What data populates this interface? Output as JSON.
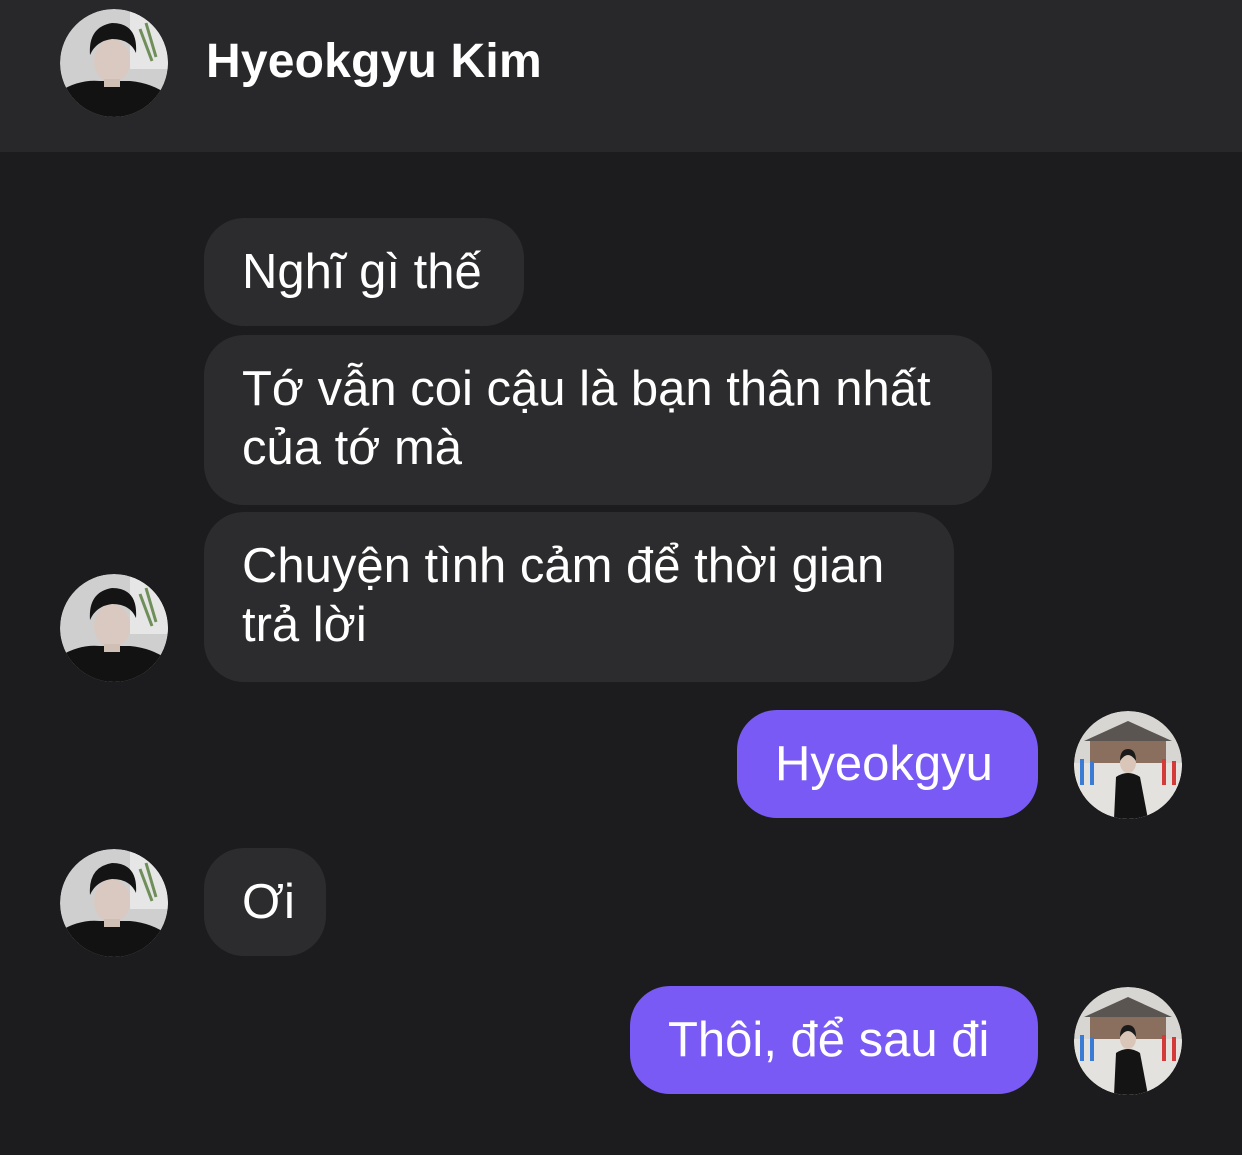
{
  "colors": {
    "background": "#1c1c1e",
    "header_background": "#28282a",
    "incoming_bubble": "#2c2c2e",
    "outgoing_bubble": "#7a5af5",
    "text": "#ffffff"
  },
  "header": {
    "contact_name": "Hyeokgyu Kim",
    "avatar_icon": "contact-avatar-icon"
  },
  "messages": [
    {
      "direction": "incoming",
      "text": "Nghĩ gì thế"
    },
    {
      "direction": "incoming",
      "text": "Tớ vẫn coi cậu là bạn thân nhất của tớ mà"
    },
    {
      "direction": "incoming",
      "text": "Chuyện tình cảm để thời gian trả lời"
    },
    {
      "direction": "outgoing",
      "text": "Hyeokgyu"
    },
    {
      "direction": "incoming",
      "text": "Ơi"
    },
    {
      "direction": "outgoing",
      "text": "Thôi, để sau đi"
    }
  ]
}
